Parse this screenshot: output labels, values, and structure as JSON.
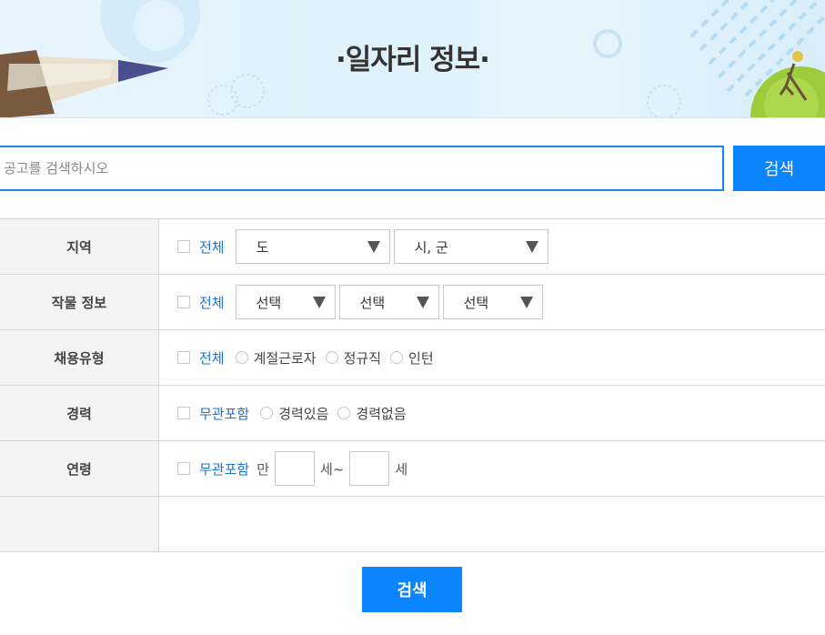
{
  "banner": {
    "title": "·일자리 정보·"
  },
  "search": {
    "placeholder": "공고를 검색하시오",
    "value": "",
    "button_label": "검색"
  },
  "filters": {
    "region": {
      "label": "지역",
      "all_label": "전체",
      "province_select": "도",
      "city_select": "시, 군"
    },
    "crop": {
      "label": "작물 정보",
      "all_label": "전체",
      "selects": [
        "선택",
        "선택",
        "선택"
      ]
    },
    "employment": {
      "label": "채용유형",
      "all_label": "전체",
      "options": [
        "계절근로자",
        "정규직",
        "인턴"
      ]
    },
    "career": {
      "label": "경력",
      "all_label": "무관포함",
      "options": [
        "경력있음",
        "경력없음"
      ]
    },
    "age": {
      "label": "연령",
      "all_label": "무관포함",
      "prefix": "만",
      "mid": "세~",
      "suffix": "세",
      "min_value": "",
      "max_value": ""
    },
    "extra": {
      "label": ""
    }
  },
  "bottom": {
    "search_label": "검색"
  }
}
